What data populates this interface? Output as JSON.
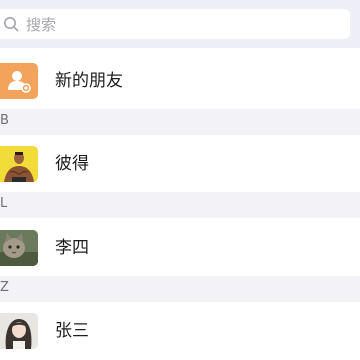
{
  "search": {
    "placeholder": "搜索",
    "icon": "search-icon"
  },
  "new_friends": {
    "label": "新的朋友",
    "icon": "new-friend-icon",
    "icon_color": "#f3a35b"
  },
  "sections": [
    {
      "letter": "B",
      "contacts": [
        {
          "name": "彼得",
          "avatar": "avatar-muscle-man"
        }
      ]
    },
    {
      "letter": "L",
      "contacts": [
        {
          "name": "李四",
          "avatar": "avatar-cat"
        }
      ]
    },
    {
      "letter": "Z",
      "contacts": [
        {
          "name": "张三",
          "avatar": "avatar-girl"
        }
      ]
    }
  ],
  "colors": {
    "page_bg": "#eeeef6",
    "section_header_bg": "#f3f3f7",
    "text": "#1c1c1c",
    "section_letter": "#6f6f76"
  }
}
